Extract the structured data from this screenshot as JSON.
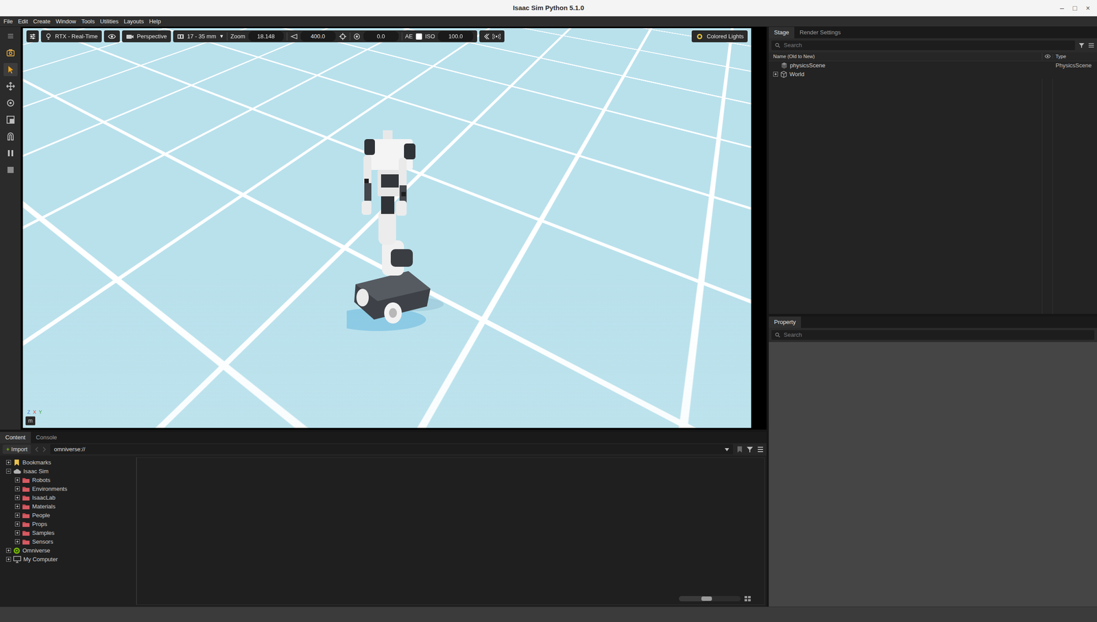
{
  "window": {
    "title": "Isaac Sim Python 5.1.0",
    "controls": [
      "–",
      "□",
      "×"
    ]
  },
  "menu": [
    "File",
    "Edit",
    "Create",
    "Window",
    "Tools",
    "Utilities",
    "Layouts",
    "Help"
  ],
  "tools": [
    {
      "selected": false
    },
    {
      "selected": false
    },
    {
      "selected": true
    },
    {
      "selected": false
    },
    {
      "selected": false
    },
    {
      "selected": false
    },
    {
      "selected": false
    },
    {
      "selected": false
    },
    {
      "selected": false
    }
  ],
  "viewport": {
    "renderer": "RTX - Real-Time",
    "camera": "Perspective",
    "lens": "17 - 35 mm",
    "lens_arrow": "▼",
    "zoom_label": "Zoom",
    "zoom": "18.148",
    "speed": "400.0",
    "exposure": "0.0",
    "ae_label": "AE",
    "ae_checked": false,
    "iso_label": "ISO",
    "iso": "100.0",
    "lights": "Colored Lights",
    "unit": "m",
    "axes": [
      "Z",
      "X",
      "Y"
    ]
  },
  "stage": {
    "tabs": [
      {
        "label": "Stage",
        "selected": true
      },
      {
        "label": "Render Settings",
        "selected": false
      }
    ],
    "search": {
      "placeholder": "Search"
    },
    "columns": [
      "Name (Old to New)",
      "Type"
    ],
    "rows": [
      {
        "name": "physicsScene",
        "type": "PhysicsScene",
        "kind": "scene",
        "expandable": false,
        "expanded": false
      },
      {
        "name": "World",
        "type": "",
        "kind": "xform",
        "expandable": true,
        "expanded": false
      }
    ]
  },
  "property": {
    "tabs": [
      {
        "label": "Property",
        "selected": true
      }
    ],
    "search": {
      "placeholder": "Search"
    }
  },
  "content": {
    "tabs": [
      {
        "label": "Content",
        "selected": true
      },
      {
        "label": "Console",
        "selected": false
      }
    ],
    "import_icon": "+",
    "import": "Import",
    "path": "omniverse://",
    "tree": [
      {
        "label": "Bookmarks",
        "depth": 0,
        "kind": "bookmark",
        "expanded": false
      },
      {
        "label": "Isaac Sim",
        "depth": 0,
        "kind": "cloud",
        "expanded": true
      },
      {
        "label": "Robots",
        "depth": 1,
        "kind": "folder",
        "expanded": false
      },
      {
        "label": "Environments",
        "depth": 1,
        "kind": "folder",
        "expanded": false
      },
      {
        "label": "IsaacLab",
        "depth": 1,
        "kind": "folder",
        "expanded": false
      },
      {
        "label": "Materials",
        "depth": 1,
        "kind": "folder",
        "expanded": false
      },
      {
        "label": "People",
        "depth": 1,
        "kind": "folder",
        "expanded": false
      },
      {
        "label": "Props",
        "depth": 1,
        "kind": "folder",
        "expanded": false
      },
      {
        "label": "Samples",
        "depth": 1,
        "kind": "folder",
        "expanded": false
      },
      {
        "label": "Sensors",
        "depth": 1,
        "kind": "folder",
        "expanded": false
      },
      {
        "label": "Omniverse",
        "depth": 0,
        "kind": "omniverse",
        "expanded": false
      },
      {
        "label": "My Computer",
        "depth": 0,
        "kind": "computer",
        "expanded": false
      }
    ],
    "thumbnail_size": {
      "level": 0.45
    }
  }
}
